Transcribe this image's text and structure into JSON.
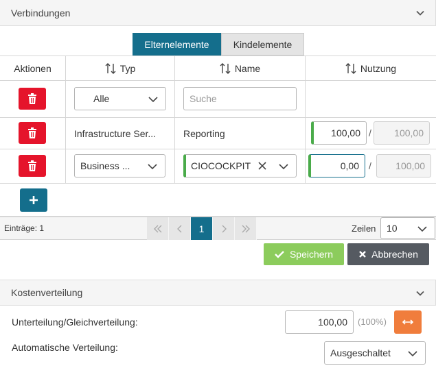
{
  "connections": {
    "title": "Verbindungen",
    "tabs": [
      {
        "label": "Elternelemente",
        "active": true
      },
      {
        "label": "Kindelemente",
        "active": false
      }
    ],
    "columns": [
      "Aktionen",
      "Typ",
      "Name",
      "Nutzung"
    ],
    "filter": {
      "type_value": "Alle",
      "name_placeholder": "Suche"
    },
    "rows": [
      {
        "type": "Infrastructure Ser...",
        "name": "Reporting",
        "usage": "100,00",
        "max": "100,00"
      },
      {
        "type_select": "Business ...",
        "name_select": "CIOCOCKPIT",
        "usage_input": "0,00",
        "max": "100,00"
      }
    ],
    "pager": {
      "entries_label": "Einträge: 1",
      "first": "«",
      "prev": "‹",
      "current_page": "1",
      "next": "›",
      "last": "»",
      "rows_label": "Zeilen",
      "rows_value": "10"
    },
    "buttons": {
      "save": "Speichern",
      "cancel": "Abbrechen"
    }
  },
  "cost": {
    "title": "Kostenverteilung",
    "split_label": "Unterteilung/Gleichverteilung:",
    "split_value": "100,00",
    "split_percent": "(100%)",
    "auto_label": "Automatische Verteilung:",
    "auto_value": "Ausgeschaltet"
  },
  "colors": {
    "primary": "#146e8c",
    "danger": "#e5142b",
    "success": "#8ccc5c",
    "dark": "#555a61",
    "warning": "#f07d3c",
    "valid": "#4aab4a"
  },
  "icons": {
    "delete": "trash-icon",
    "add": "plus-icon",
    "sort": "sort-icon",
    "chevron": "chevron-down-icon",
    "clear": "close-icon",
    "check": "check-icon",
    "cancel": "x-icon",
    "swap": "arrows-horizontal-icon"
  }
}
